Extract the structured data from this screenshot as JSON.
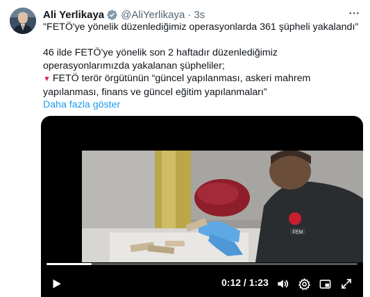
{
  "author": {
    "name": "Ali Yerlikaya",
    "handle": "@AliYerlikaya",
    "separator": "·",
    "time": "3s"
  },
  "tweet": {
    "headline": "\"FETÖ'ye yönelik düzenlediğimiz operasyonlarda 361 şüpheli yakalandı\"",
    "body_line1": "46 ilde FETÖ'ye yönelik son 2 haftadır düzenlediğimiz operasyonlarımızda yakalanan şüpheliler;",
    "bullet_marker": "🔻",
    "bullet_text": "FETÖ terör örgütünün “güncel yapılanması, askeri mahrem yapılanması, finans ve güncel eğitim yapılanmaları”",
    "show_more": "Daha fazla göster"
  },
  "video": {
    "current_time": "0:12",
    "time_separator": "/",
    "duration": "1:23",
    "progress_fraction": 0.145,
    "badge_text": "FEM"
  },
  "icons": {
    "verified": "verified-badge-icon",
    "more": "more-horizontal-icon",
    "play": "play-icon",
    "volume": "volume-icon",
    "settings": "settings-gear-icon",
    "fullscreen": "fullscreen-icon"
  },
  "colors": {
    "accent": "#1d9bf0",
    "text": "#0f1419",
    "muted": "#536471",
    "video_bg": "#000000",
    "glove": "#5ea8e6"
  }
}
